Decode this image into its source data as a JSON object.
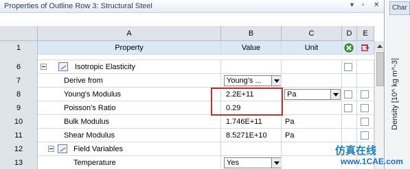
{
  "window": {
    "title": "Properties of Outline Row 3: Structural Steel",
    "controls": [
      "▾",
      "▫",
      "✕"
    ]
  },
  "columns": {
    "letters": [
      "A",
      "B",
      "C",
      "D",
      "E"
    ],
    "row_number": "1",
    "property": "Property",
    "value": "Value",
    "unit": "Unit"
  },
  "rows": [
    {
      "num": "6",
      "property": "Isotropic Elasticity",
      "value": "",
      "unit": ""
    },
    {
      "num": "7",
      "property": "Derive from",
      "value": "Young's ...",
      "unit": ""
    },
    {
      "num": "8",
      "property": "Young's Modulus",
      "value": "2.2E+11",
      "unit": "Pa"
    },
    {
      "num": "9",
      "property": "Poisson's Ratio",
      "value": "0.29",
      "unit": ""
    },
    {
      "num": "10",
      "property": "Bulk Modulus",
      "value": "1.746E+11",
      "unit": "Pa"
    },
    {
      "num": "11",
      "property": "Shear Modulus",
      "value": "8.5271E+10",
      "unit": "Pa"
    },
    {
      "num": "12",
      "property": "Field Variables",
      "value": "",
      "unit": ""
    },
    {
      "num": "13",
      "property": "Temperature",
      "value": "Yes",
      "unit": ""
    }
  ],
  "right_panel": {
    "tab_label": "Char",
    "axis_label": "Density  [10^ kg m^-3]"
  },
  "watermark": {
    "text": "仿真在线",
    "url": "www.1CAE.com"
  },
  "colors": {
    "highlight": "#c0302a",
    "header_bg": "#dfe3ea",
    "property_header_bg": "#dbe8f6"
  }
}
